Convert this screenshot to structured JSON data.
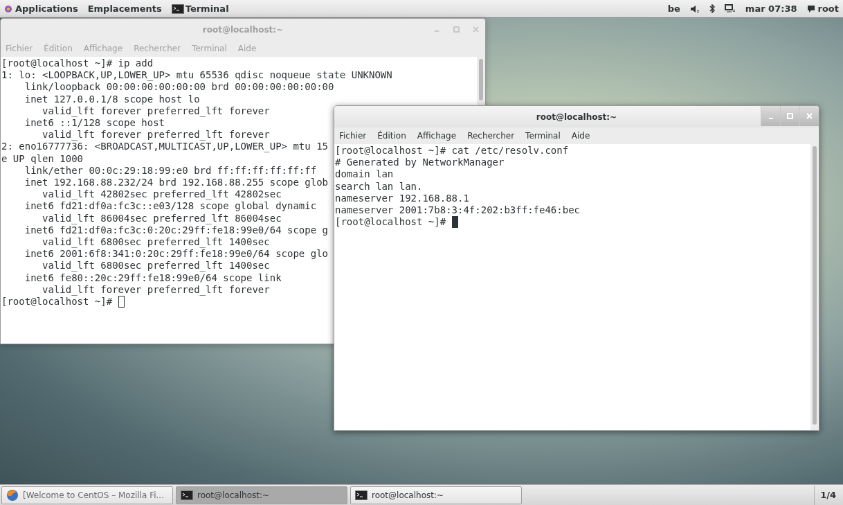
{
  "top_bar": {
    "menus": [
      "Applications",
      "Emplacements"
    ],
    "active_app": "Terminal",
    "keyboard": "be",
    "clock": "mar 07:38",
    "user": "root"
  },
  "windows": [
    {
      "title": "root@localhost:~",
      "focused": false,
      "menu": [
        "Fichier",
        "Édition",
        "Affichage",
        "Rechercher",
        "Terminal",
        "Aide"
      ],
      "lines": [
        "[root@localhost ~]# ip add",
        "1: lo: <LOOPBACK,UP,LOWER_UP> mtu 65536 qdisc noqueue state UNKNOWN",
        "    link/loopback 00:00:00:00:00:00 brd 00:00:00:00:00:00",
        "    inet 127.0.0.1/8 scope host lo",
        "       valid_lft forever preferred_lft forever",
        "    inet6 ::1/128 scope host",
        "       valid_lft forever preferred_lft forever",
        "2: eno16777736: <BROADCAST,MULTICAST,UP,LOWER_UP> mtu 15",
        "e UP qlen 1000",
        "    link/ether 00:0c:29:18:99:e0 brd ff:ff:ff:ff:ff:ff",
        "    inet 192.168.88.232/24 brd 192.168.88.255 scope glob",
        "       valid_lft 42802sec preferred_lft 42802sec",
        "    inet6 fd21:df0a:fc3c::e03/128 scope global dynamic",
        "       valid_lft 86004sec preferred_lft 86004sec",
        "    inet6 fd21:df0a:fc3c:0:20c:29ff:fe18:99e0/64 scope g",
        "       valid_lft 6800sec preferred_lft 1400sec",
        "    inet6 2001:6f8:341:0:20c:29ff:fe18:99e0/64 scope glo",
        "       valid_lft 6800sec preferred_lft 1400sec",
        "    inet6 fe80::20c:29ff:fe18:99e0/64 scope link",
        "       valid_lft forever preferred_lft forever",
        "[root@localhost ~]# "
      ]
    },
    {
      "title": "root@localhost:~",
      "focused": true,
      "menu": [
        "Fichier",
        "Édition",
        "Affichage",
        "Rechercher",
        "Terminal",
        "Aide"
      ],
      "lines": [
        "[root@localhost ~]# cat /etc/resolv.conf",
        "# Generated by NetworkManager",
        "domain lan",
        "search lan lan.",
        "nameserver 192.168.88.1",
        "nameserver 2001:7b8:3:4f:202:b3ff:fe46:bec",
        "[root@localhost ~]# "
      ]
    }
  ],
  "taskbar": {
    "items": [
      {
        "kind": "browser",
        "label": "[Welcome to CentOS – Mozilla Fi...",
        "selected": false
      },
      {
        "kind": "terminal",
        "label": "root@localhost:~",
        "selected": true
      },
      {
        "kind": "terminal",
        "label": "root@localhost:~",
        "selected": false
      }
    ],
    "workspace": "1/4"
  }
}
